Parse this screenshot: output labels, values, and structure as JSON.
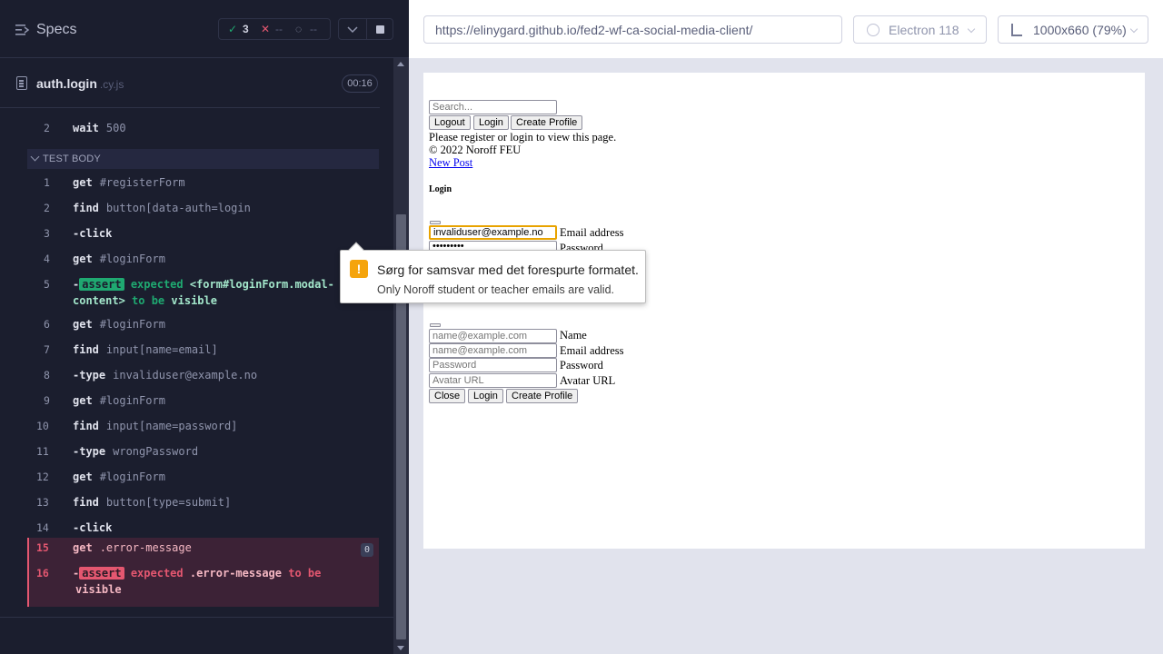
{
  "runner": {
    "specs_label": "Specs",
    "stats": {
      "passed": "3",
      "failed": "--",
      "pending": "--"
    },
    "spec": {
      "name": "auth.login",
      "ext": ".cy.js",
      "duration": "00:16"
    },
    "test_body_label": "TEST BODY",
    "pre_row": {
      "num": "2",
      "cmd": "wait",
      "arg": "500"
    },
    "commands": [
      {
        "num": "1",
        "cmd": "get",
        "arg": "#registerForm"
      },
      {
        "num": "2",
        "cmd": "find",
        "arg": "button[data-auth=login"
      },
      {
        "num": "3",
        "cmd": "-click",
        "arg": ""
      },
      {
        "num": "4",
        "cmd": "get",
        "arg": "#loginForm"
      },
      {
        "num": "5",
        "cmd": "-assert",
        "arg": "expected <form#loginForm.modal-content> to be visible"
      },
      {
        "num": "6",
        "cmd": "get",
        "arg": "#loginForm"
      },
      {
        "num": "7",
        "cmd": "find",
        "arg": "input[name=email]"
      },
      {
        "num": "8",
        "cmd": "-type",
        "arg": "invaliduser@example.no"
      },
      {
        "num": "9",
        "cmd": "get",
        "arg": "#loginForm"
      },
      {
        "num": "10",
        "cmd": "find",
        "arg": "input[name=password]"
      },
      {
        "num": "11",
        "cmd": "-type",
        "arg": "wrongPassword"
      },
      {
        "num": "12",
        "cmd": "get",
        "arg": "#loginForm"
      },
      {
        "num": "13",
        "cmd": "find",
        "arg": "button[type=submit]"
      },
      {
        "num": "14",
        "cmd": "-click",
        "arg": ""
      },
      {
        "num": "15",
        "cmd": "get",
        "arg": ".error-message"
      },
      {
        "num": "16",
        "cmd": "-assert",
        "arg": "expected .error-message to be visible"
      }
    ],
    "assert5": {
      "tag": "assert",
      "expected": "expected",
      "subject_1": "<form#loginForm.modal-",
      "subject_2": "content>",
      "to_be": "to be",
      "visible": "visible"
    },
    "assert16": {
      "tag": "assert",
      "expected": "expected",
      "subject": ".error-message",
      "to_be": "to be",
      "visible": "visible"
    },
    "fail_count": "0"
  },
  "browser": {
    "url": "https://elinygard.github.io/fed2-wf-ca-social-media-client/",
    "browser_name": "Electron 118",
    "viewport": "1000x660",
    "zoom": "(79%)"
  },
  "app": {
    "search_placeholder": "Search...",
    "logout": "Logout",
    "login": "Login",
    "create_profile": "Create Profile",
    "please_register": "Please register or login to view this page.",
    "copyright": "© 2022 Noroff FEU",
    "new_post": "New Post",
    "login_heading": "Login",
    "email_value": "invaliduser@example.no",
    "email_label": "Email address",
    "password_value": "•••••••••",
    "password_label": "Password",
    "reg_name_placeholder": "name@example.com",
    "reg_name_label": "Name",
    "reg_email_placeholder": "name@example.com",
    "reg_email_label": "Email address",
    "reg_password_placeholder": "Password",
    "reg_password_label": "Password",
    "reg_avatar_placeholder": "Avatar URL",
    "reg_avatar_label": "Avatar URL",
    "close": "Close",
    "login2": "Login",
    "create_profile2": "Create Profile"
  },
  "validation": {
    "message": "Sørg for samsvar med det forespurte formatet.",
    "hint": "Only Noroff student or teacher emails are valid.",
    "icon": "!"
  },
  "colors": {
    "pass": "#1fa971",
    "fail": "#e45770",
    "warning": "#f5a40c"
  }
}
